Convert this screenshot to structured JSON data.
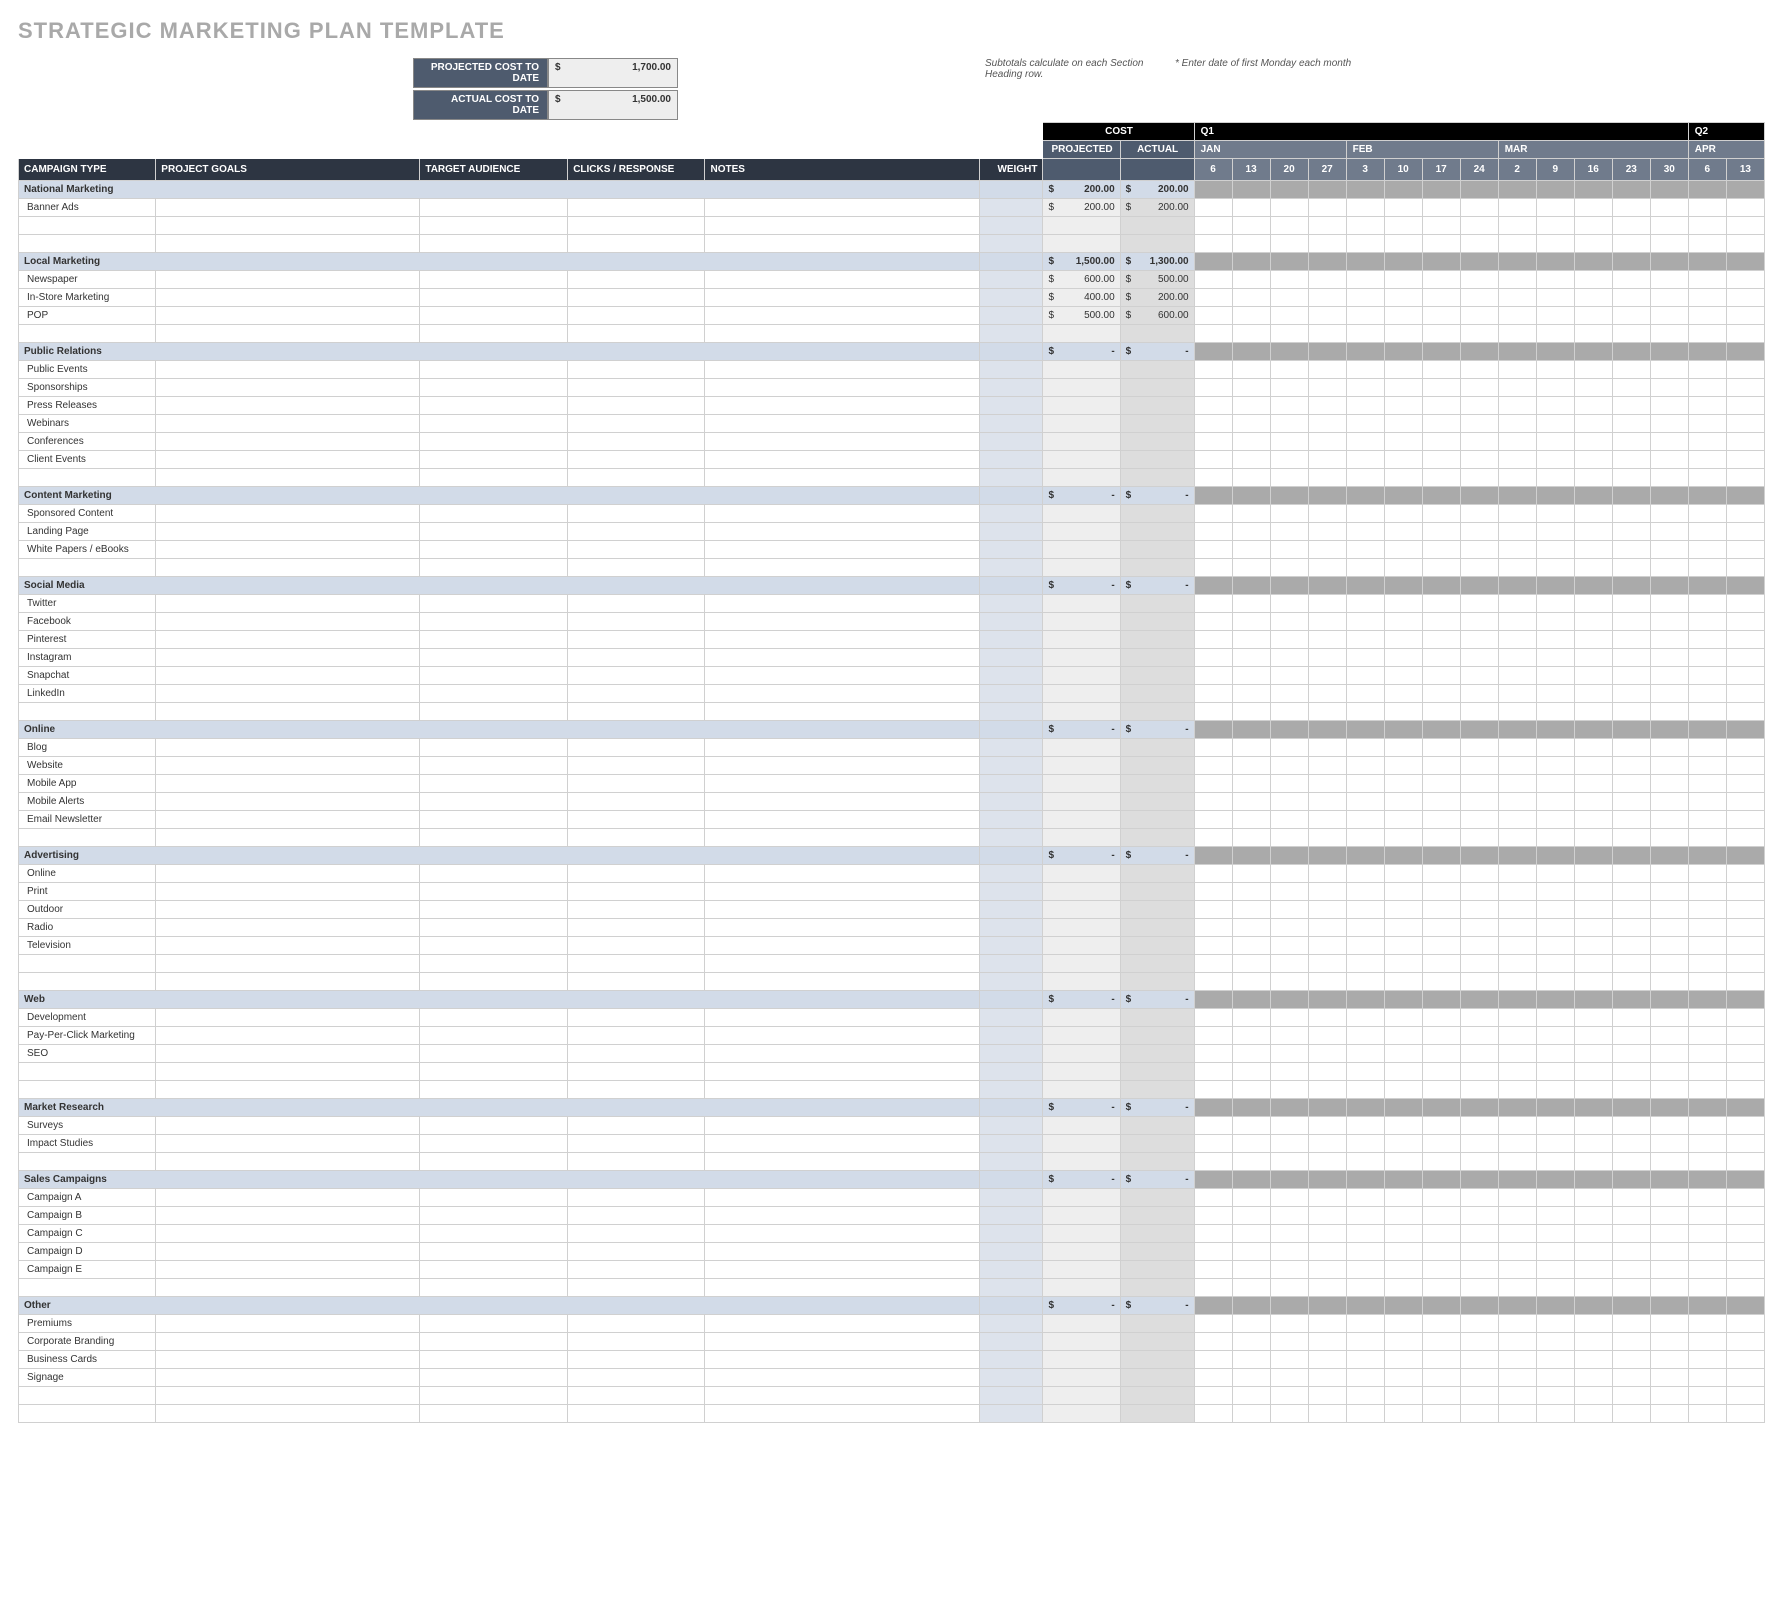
{
  "title": "STRATEGIC MARKETING PLAN TEMPLATE",
  "summary": {
    "proj_label": "PROJECTED COST TO DATE",
    "proj_sym": "$",
    "proj_val": "1,700.00",
    "act_label": "ACTUAL COST TO DATE",
    "act_sym": "$",
    "act_val": "1,500.00"
  },
  "hints": {
    "subtotals": "Subtotals calculate on each Section Heading row.",
    "calendar": "* Enter date of first Monday each month"
  },
  "quarters": {
    "q1": "Q1",
    "q2": "Q2"
  },
  "months": [
    "JAN",
    "FEB",
    "MAR",
    "APR"
  ],
  "days": [
    "6",
    "13",
    "20",
    "27",
    "3",
    "10",
    "17",
    "24",
    "2",
    "9",
    "16",
    "23",
    "30",
    "6",
    "13"
  ],
  "cost_header": {
    "title": "COST",
    "proj": "PROJECTED",
    "act": "ACTUAL"
  },
  "cols": {
    "type": "CAMPAIGN TYPE",
    "goals": "PROJECT GOALS",
    "aud": "TARGET AUDIENCE",
    "clicks": "CLICKS / RESPONSE",
    "notes": "NOTES",
    "weight": "WEIGHT"
  },
  "sym": "$",
  "dash": "-",
  "sections": [
    {
      "name": "National Marketing",
      "proj": "200.00",
      "act": "200.00",
      "rows": [
        {
          "label": "Banner Ads",
          "proj": "200.00",
          "act": "200.00"
        },
        {
          "label": ""
        },
        {
          "label": ""
        }
      ]
    },
    {
      "name": "Local Marketing",
      "proj": "1,500.00",
      "act": "1,300.00",
      "rows": [
        {
          "label": "Newspaper",
          "proj": "600.00",
          "act": "500.00"
        },
        {
          "label": "In-Store Marketing",
          "proj": "400.00",
          "act": "200.00"
        },
        {
          "label": "POP",
          "proj": "500.00",
          "act": "600.00"
        },
        {
          "label": ""
        }
      ]
    },
    {
      "name": "Public Relations",
      "proj": "-",
      "act": "-",
      "rows": [
        {
          "label": "Public Events"
        },
        {
          "label": "Sponsorships"
        },
        {
          "label": "Press Releases"
        },
        {
          "label": "Webinars"
        },
        {
          "label": "Conferences"
        },
        {
          "label": "Client Events"
        },
        {
          "label": ""
        }
      ]
    },
    {
      "name": "Content Marketing",
      "proj": "-",
      "act": "-",
      "rows": [
        {
          "label": "Sponsored Content"
        },
        {
          "label": "Landing Page"
        },
        {
          "label": "White Papers / eBooks"
        },
        {
          "label": ""
        }
      ]
    },
    {
      "name": "Social Media",
      "proj": "-",
      "act": "-",
      "rows": [
        {
          "label": "Twitter"
        },
        {
          "label": "Facebook"
        },
        {
          "label": "Pinterest"
        },
        {
          "label": "Instagram"
        },
        {
          "label": "Snapchat"
        },
        {
          "label": "LinkedIn"
        },
        {
          "label": ""
        }
      ]
    },
    {
      "name": "Online",
      "proj": "-",
      "act": "-",
      "rows": [
        {
          "label": "Blog"
        },
        {
          "label": "Website"
        },
        {
          "label": "Mobile App"
        },
        {
          "label": "Mobile Alerts"
        },
        {
          "label": "Email Newsletter"
        },
        {
          "label": ""
        }
      ]
    },
    {
      "name": "Advertising",
      "proj": "-",
      "act": "-",
      "rows": [
        {
          "label": "Online"
        },
        {
          "label": "Print"
        },
        {
          "label": "Outdoor"
        },
        {
          "label": "Radio"
        },
        {
          "label": "Television"
        },
        {
          "label": ""
        },
        {
          "label": ""
        }
      ]
    },
    {
      "name": "Web",
      "proj": "-",
      "act": "-",
      "rows": [
        {
          "label": "Development"
        },
        {
          "label": "Pay-Per-Click Marketing"
        },
        {
          "label": "SEO"
        },
        {
          "label": ""
        },
        {
          "label": ""
        }
      ]
    },
    {
      "name": "Market Research",
      "proj": "-",
      "act": "-",
      "rows": [
        {
          "label": "Surveys"
        },
        {
          "label": "Impact Studies"
        },
        {
          "label": ""
        }
      ]
    },
    {
      "name": "Sales Campaigns",
      "proj": "-",
      "act": "-",
      "rows": [
        {
          "label": "Campaign A"
        },
        {
          "label": "Campaign B"
        },
        {
          "label": "Campaign C"
        },
        {
          "label": "Campaign D"
        },
        {
          "label": "Campaign E"
        },
        {
          "label": ""
        }
      ]
    },
    {
      "name": "Other",
      "proj": "-",
      "act": "-",
      "rows": [
        {
          "label": "Premiums"
        },
        {
          "label": "Corporate Branding"
        },
        {
          "label": "Business Cards"
        },
        {
          "label": "Signage"
        },
        {
          "label": ""
        },
        {
          "label": ""
        }
      ]
    }
  ]
}
